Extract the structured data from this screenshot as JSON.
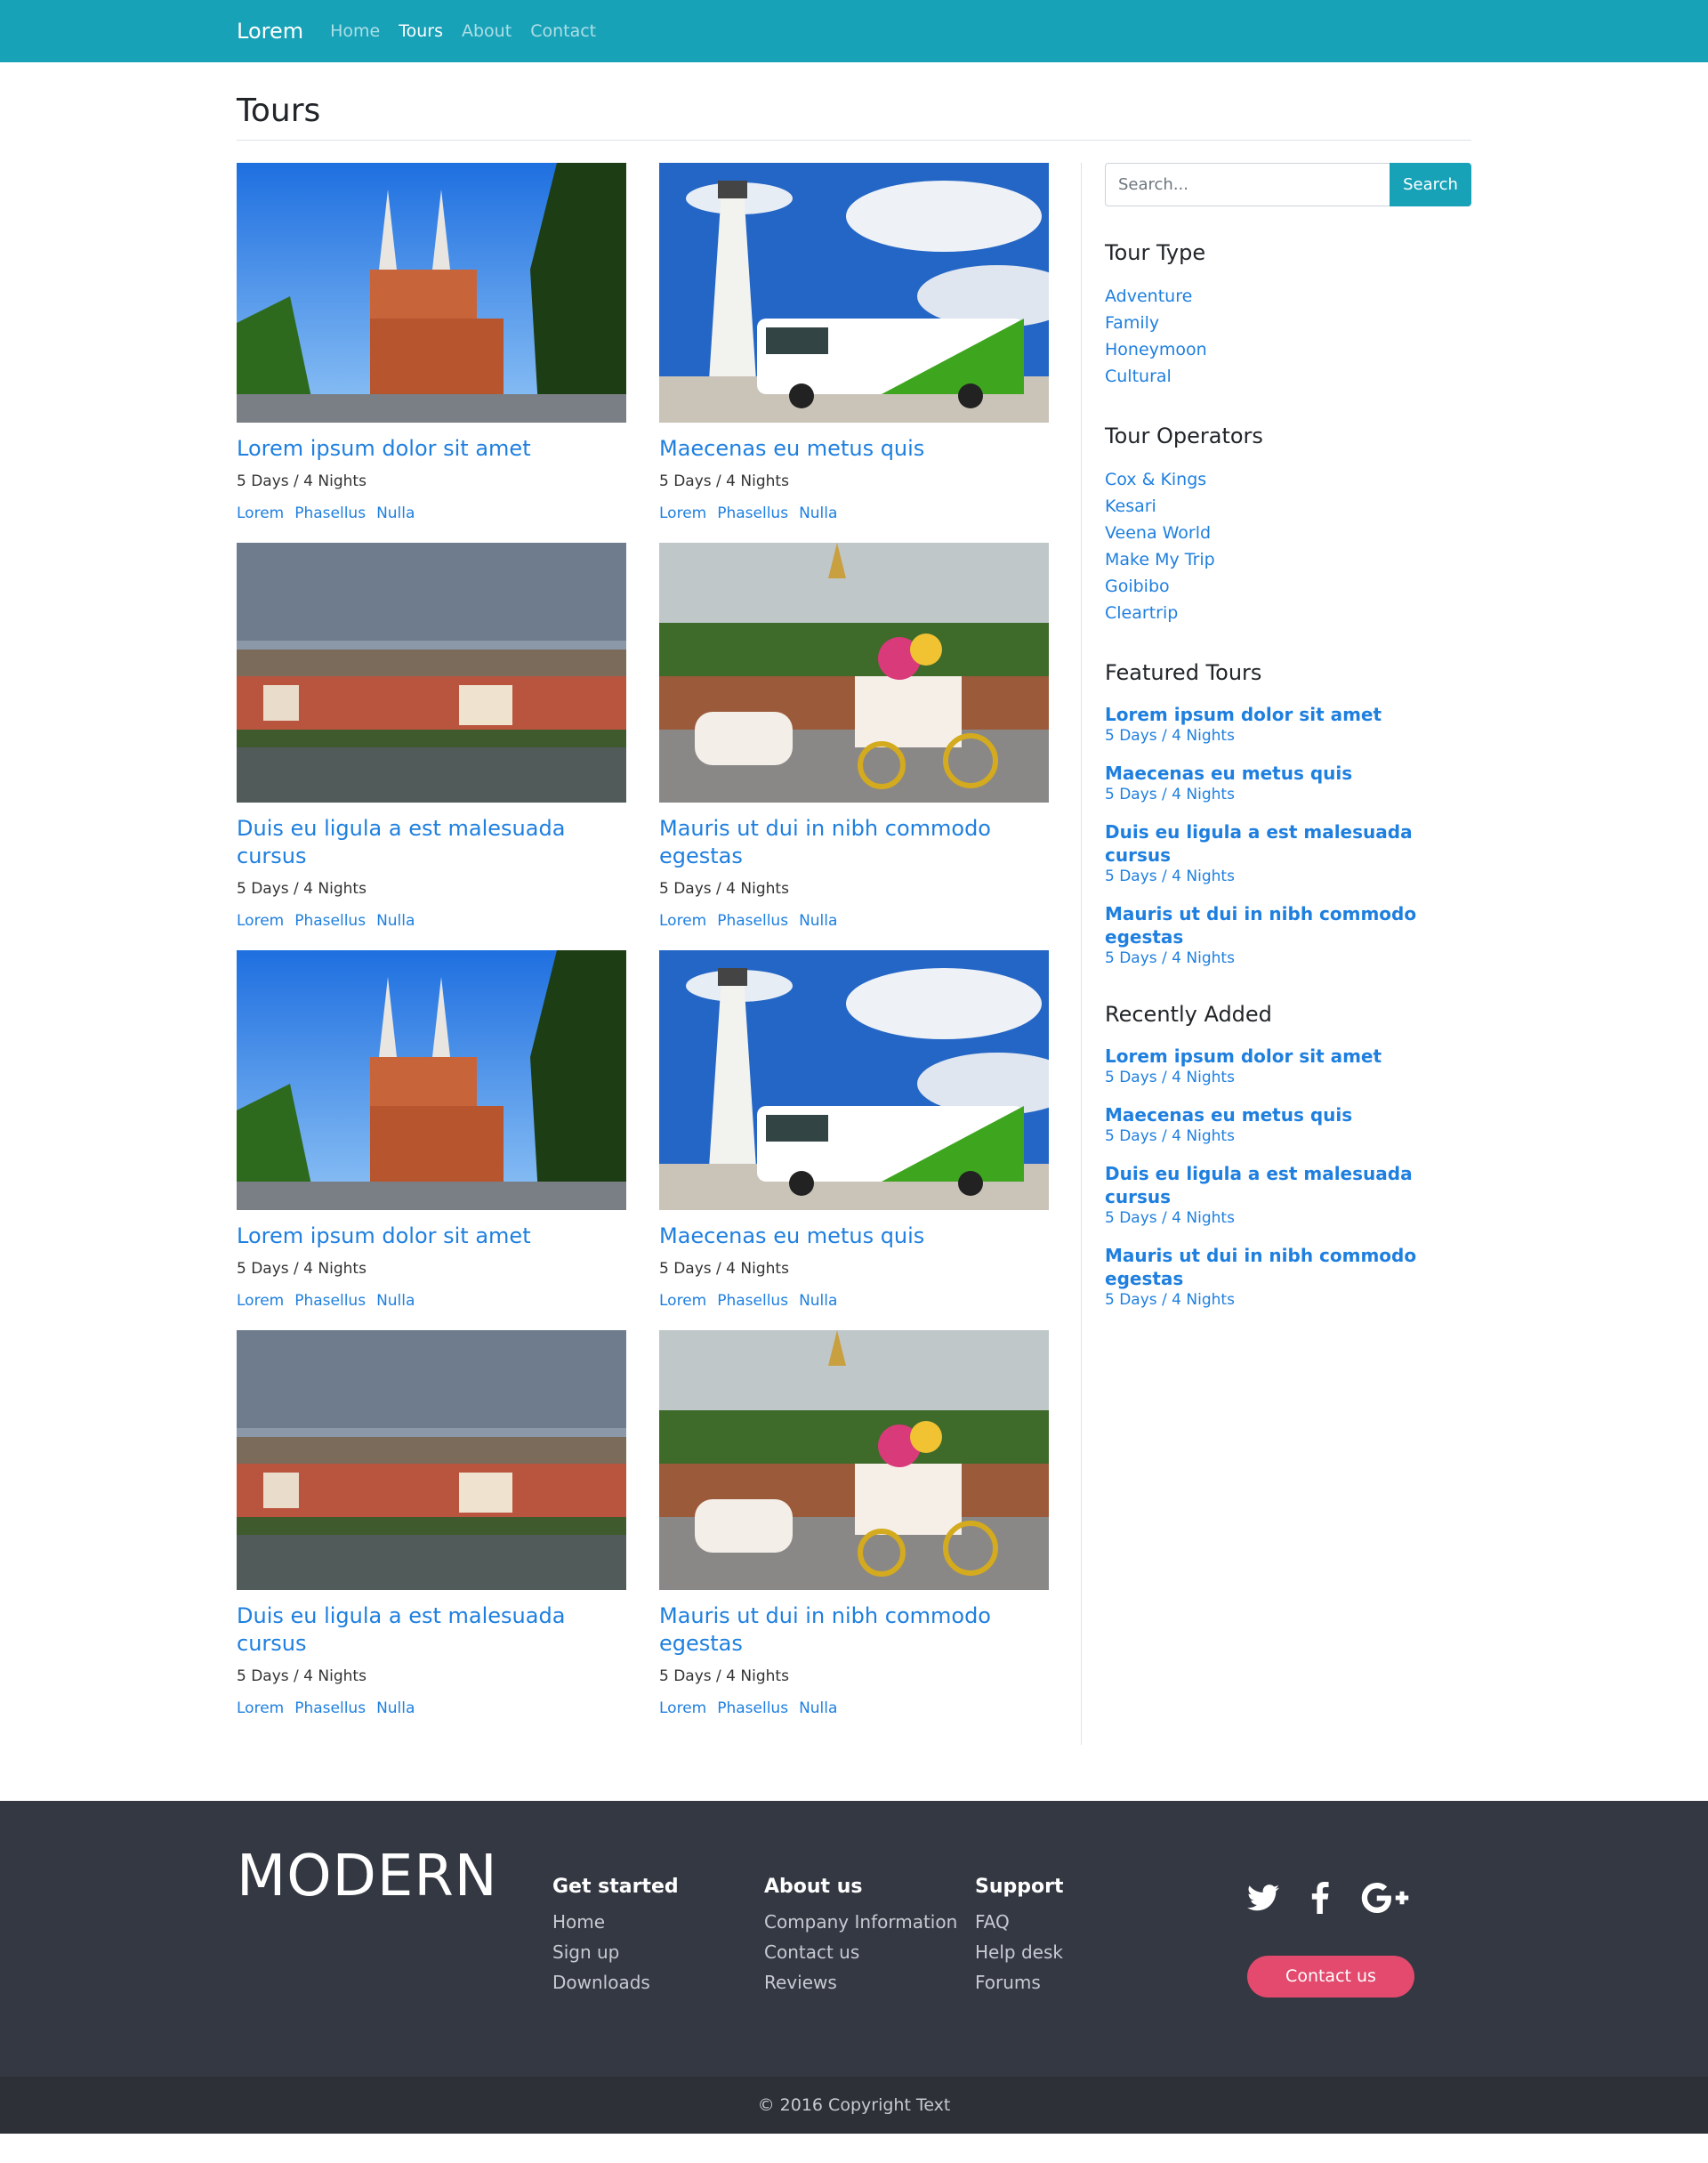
{
  "nav": {
    "brand": "Lorem",
    "links": [
      "Home",
      "Tours",
      "About",
      "Contact"
    ],
    "active": "Tours"
  },
  "page_title": "Tours",
  "tours": [
    {
      "title": "Lorem ipsum dolor sit amet",
      "meta": "5 Days / 4 Nights",
      "tags": [
        "Lorem",
        "Phasellus",
        "Nulla"
      ],
      "image": "cathedral-photo"
    },
    {
      "title": "Maecenas eu metus quis",
      "meta": "5 Days / 4 Nights",
      "tags": [
        "Lorem",
        "Phasellus",
        "Nulla"
      ],
      "image": "lighthouse-bus-photo"
    },
    {
      "title": "Duis eu ligula a est malesuada cursus",
      "meta": "5 Days / 4 Nights",
      "tags": [
        "Lorem",
        "Phasellus",
        "Nulla"
      ],
      "image": "riverside-city-photo"
    },
    {
      "title": "Mauris ut dui in nibh commodo egestas",
      "meta": "5 Days / 4 Nights",
      "tags": [
        "Lorem",
        "Phasellus",
        "Nulla"
      ],
      "image": "horse-carriage-photo"
    },
    {
      "title": "Lorem ipsum dolor sit amet",
      "meta": "5 Days / 4 Nights",
      "tags": [
        "Lorem",
        "Phasellus",
        "Nulla"
      ],
      "image": "cathedral-photo"
    },
    {
      "title": "Maecenas eu metus quis",
      "meta": "5 Days / 4 Nights",
      "tags": [
        "Lorem",
        "Phasellus",
        "Nulla"
      ],
      "image": "lighthouse-bus-photo"
    },
    {
      "title": "Duis eu ligula a est malesuada cursus",
      "meta": "5 Days / 4 Nights",
      "tags": [
        "Lorem",
        "Phasellus",
        "Nulla"
      ],
      "image": "riverside-city-photo"
    },
    {
      "title": "Mauris ut dui in nibh commodo egestas",
      "meta": "5 Days / 4 Nights",
      "tags": [
        "Lorem",
        "Phasellus",
        "Nulla"
      ],
      "image": "horse-carriage-photo"
    }
  ],
  "sidebar": {
    "search": {
      "placeholder": "Search...",
      "button": "Search"
    },
    "tour_type": {
      "title": "Tour Type",
      "items": [
        "Adventure",
        "Family",
        "Honeymoon",
        "Cultural"
      ]
    },
    "operators": {
      "title": "Tour Operators",
      "items": [
        "Cox & Kings",
        "Kesari",
        "Veena World",
        "Make My Trip",
        "Goibibo",
        "Cleartrip"
      ]
    },
    "featured": {
      "title": "Featured Tours",
      "items": [
        {
          "title": "Lorem ipsum dolor sit amet",
          "meta": "5 Days / 4 Nights"
        },
        {
          "title": "Maecenas eu metus quis",
          "meta": "5 Days / 4 Nights"
        },
        {
          "title": "Duis eu ligula a est malesuada cursus",
          "meta": "5 Days / 4 Nights"
        },
        {
          "title": "Mauris ut dui in nibh commodo egestas",
          "meta": "5 Days / 4 Nights"
        }
      ]
    },
    "recent": {
      "title": "Recently Added",
      "items": [
        {
          "title": "Lorem ipsum dolor sit amet",
          "meta": "5 Days / 4 Nights"
        },
        {
          "title": "Maecenas eu metus quis",
          "meta": "5 Days / 4 Nights"
        },
        {
          "title": "Duis eu ligula a est malesuada cursus",
          "meta": "5 Days / 4 Nights"
        },
        {
          "title": "Mauris ut dui in nibh commodo egestas",
          "meta": "5 Days / 4 Nights"
        }
      ]
    }
  },
  "footer": {
    "brand": "MODERN",
    "columns": [
      {
        "title": "Get started",
        "links": [
          "Home",
          "Sign up",
          "Downloads"
        ]
      },
      {
        "title": "About us",
        "links": [
          "Company Information",
          "Contact us",
          "Reviews"
        ]
      },
      {
        "title": "Support",
        "links": [
          "FAQ",
          "Help desk",
          "Forums"
        ]
      }
    ],
    "social": [
      "twitter-icon",
      "facebook-icon",
      "google-plus-icon"
    ],
    "contact_button": "Contact us",
    "copyright": "© 2016 Copyright Text"
  },
  "colors": {
    "nav": "#17a2b8",
    "link": "#1e7fdf",
    "footer": "#343842",
    "contact_button": "#e34a6e"
  }
}
